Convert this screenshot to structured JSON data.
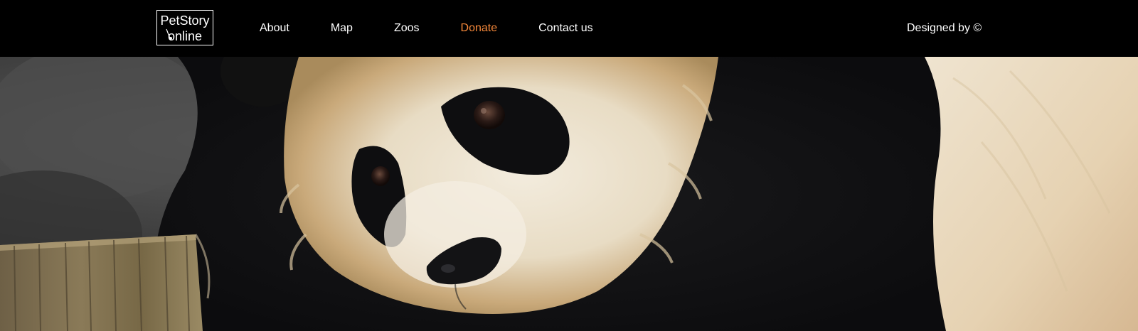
{
  "header": {
    "logo": {
      "line1": "PetStory",
      "line2": "online"
    },
    "nav": [
      {
        "label": "About",
        "active": false
      },
      {
        "label": "Map",
        "active": false
      },
      {
        "label": "Zoos",
        "active": false
      },
      {
        "label": "Donate",
        "active": true
      },
      {
        "label": "Contact us",
        "active": false
      }
    ],
    "credit": "Designed by ©"
  },
  "colors": {
    "header_bg": "#000000",
    "nav_text": "#ffffff",
    "nav_active": "#f5883a"
  },
  "hero": {
    "image": "giant-panda-closeup"
  }
}
